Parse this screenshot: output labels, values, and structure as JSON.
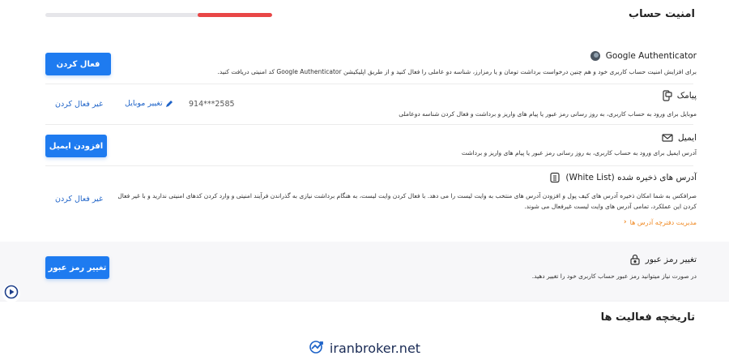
{
  "security": {
    "title": "امنیت حساب",
    "progress": 0.33
  },
  "google_auth": {
    "title": "Google Authenticator",
    "desc": "برای افزایش امنیت حساب کاربری خود و هم چنین درخواست برداشت تومان و یا رمزارز، شناسه دو عاملی را فعال کنید و از طریق اپلیکیشن  Google Authenticator کد امنیتی دریافت کنید.",
    "button": "فعال کردن"
  },
  "sms": {
    "title": "پیامک",
    "desc": "موبایل برای ورود به حساب کاربری، به روز رسانی رمز عبور یا پیام های واریز و برداشت و فعال کردن شناسه دوعاملی",
    "phone": "914***2585",
    "change_mobile": "تغییر موبایل",
    "deactivate": "غیر فعال کردن"
  },
  "email": {
    "title": "ایمیل",
    "desc": "آدرس ایمیل برای ورود به حساب کاربری، به روز رسانی رمز عبور یا پیام های واریز و برداشت",
    "button": "افزودن ایمیل"
  },
  "whitelist": {
    "title": "آدرس های ذخیره شده (White List)",
    "desc1": "صرافکس به شما امکان ذخیره آدرس های کیف پول و افزودن آدرس های منتخب به وایت لیست را می دهد. با فعال کردن وایت لیست، به هنگام برداشت نیازی به گذراندن فرآیند امنیتی و وارد کردن کدهای امنیتی ندارید و با غیر فعال",
    "desc2": "کردن این عملکرد، تمامی آدرس های وایت لیست غیرفعال می شوند.",
    "manage": "مدیریت دفترچه آدرس ها",
    "deactivate": "غیر فعال کردن"
  },
  "password": {
    "title": "تغییر رمز عبور",
    "desc": "در صورت نیاز میتوانید رمز عبور حساب کاربری خود را تغییر دهید.",
    "button": "تغییر رمز عبور"
  },
  "history": {
    "title": "تاریخچه فعالیت ها"
  },
  "footer": {
    "brand": "iranbroker.net"
  },
  "colors": {
    "accent": "#1e7bf0",
    "progress": "#e94646",
    "orange": "#f08a24"
  }
}
